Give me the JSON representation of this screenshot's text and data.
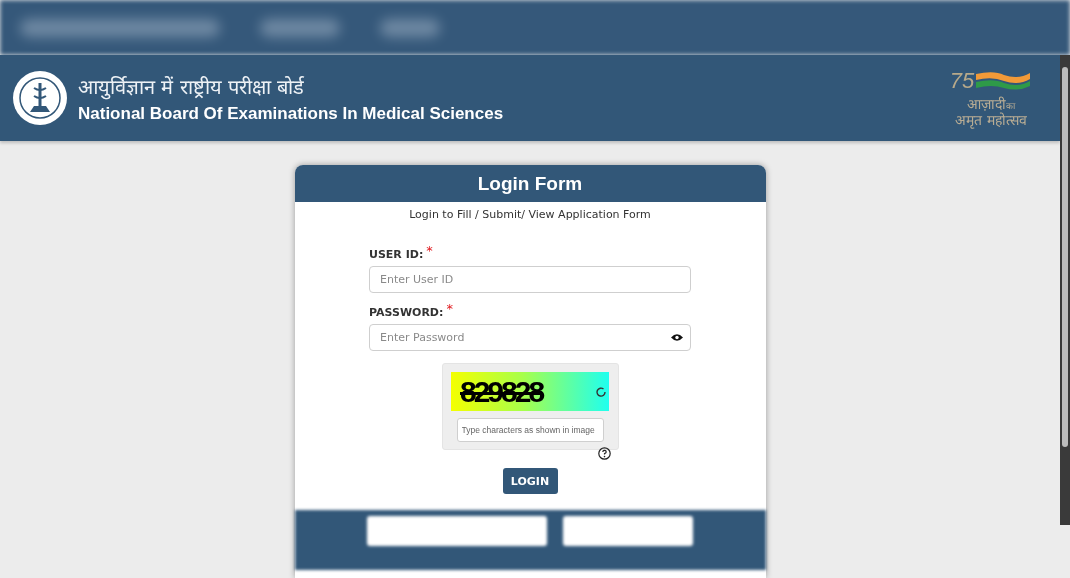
{
  "header": {
    "title_hindi": "आयुर्विज्ञान में राष्ट्रीय परीक्षा बोर्ड",
    "title": "National Board Of Examinations In Medical Sciences",
    "emblem": {
      "number": "75",
      "line1": "आज़ादी",
      "small": "का",
      "line2": "अमृत महोत्सव"
    }
  },
  "login_form": {
    "title": "Login Form",
    "subtitle": "Login to Fill / Submit/ View Application Form",
    "fields": [
      {
        "label": "USER ID:",
        "marker": "*",
        "placeholder": "Enter User ID",
        "kind": "text"
      },
      {
        "label": "PASSWORD:",
        "marker": "*",
        "placeholder": "Enter Password",
        "kind": "password"
      }
    ],
    "captcha": {
      "code": "829828",
      "placeholder": "Type characters as shown in image"
    },
    "button": "LOGIN"
  }
}
